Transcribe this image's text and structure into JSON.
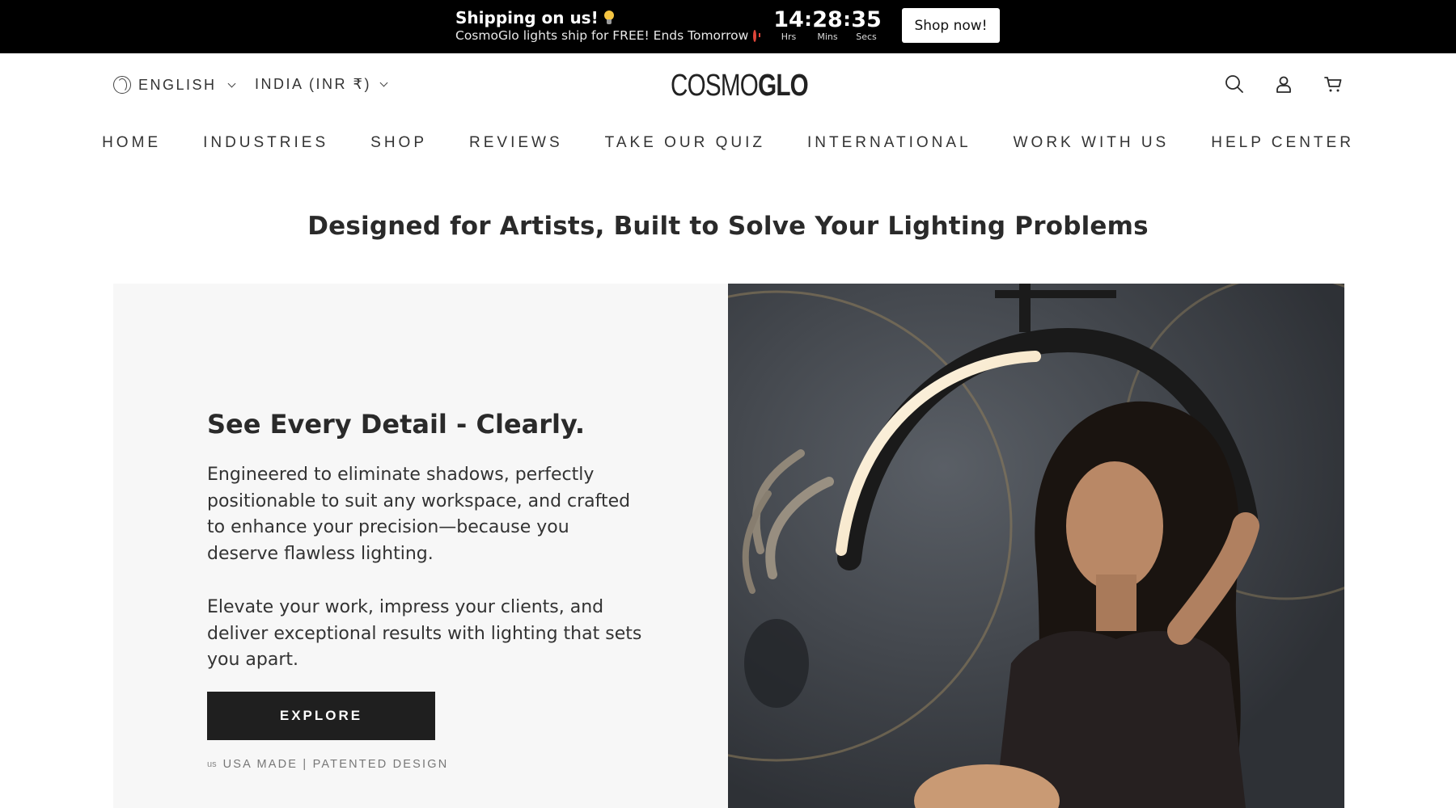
{
  "promo": {
    "title": "Shipping on us!",
    "subtitle": "CosmoGlo lights ship for FREE! Ends Tomorrow",
    "countdown": {
      "hours": "14",
      "hours_label": "Hrs",
      "minutes": "28",
      "minutes_label": "Mins",
      "seconds": "35",
      "seconds_label": "Secs"
    },
    "cta_label": "Shop now!"
  },
  "header": {
    "language": "ENGLISH",
    "currency": "INDIA (INR ₹)",
    "logo_thin": "COSMO",
    "logo_bold": "GLO",
    "icons": [
      "search-icon",
      "account-icon",
      "cart-icon"
    ]
  },
  "nav": {
    "items": [
      {
        "label": "HOME"
      },
      {
        "label": "INDUSTRIES"
      },
      {
        "label": "SHOP"
      },
      {
        "label": "REVIEWS"
      },
      {
        "label": "TAKE OUR QUIZ"
      },
      {
        "label": "INTERNATIONAL"
      },
      {
        "label": "WORK WITH US"
      },
      {
        "label": "HELP CENTER"
      }
    ]
  },
  "section": {
    "heading": "Designed for Artists, Built to Solve Your Lighting Problems"
  },
  "hero": {
    "title": "See Every Detail - Clearly.",
    "paragraph1": "Engineered to eliminate shadows, perfectly positionable to suit any workspace, and crafted to enhance your precision—because you deserve flawless lighting.",
    "paragraph2": "Elevate your work, impress your clients, and deliver exceptional results with lighting that sets you apart.",
    "button_label": "EXPLORE",
    "badge_flag": "us",
    "badge_text": "USA MADE | PATENTED DESIGN"
  },
  "colors": {
    "promo_bg": "#000000",
    "button_bg": "#1f1f1f",
    "hero_panel_bg": "#f7f7f7"
  }
}
